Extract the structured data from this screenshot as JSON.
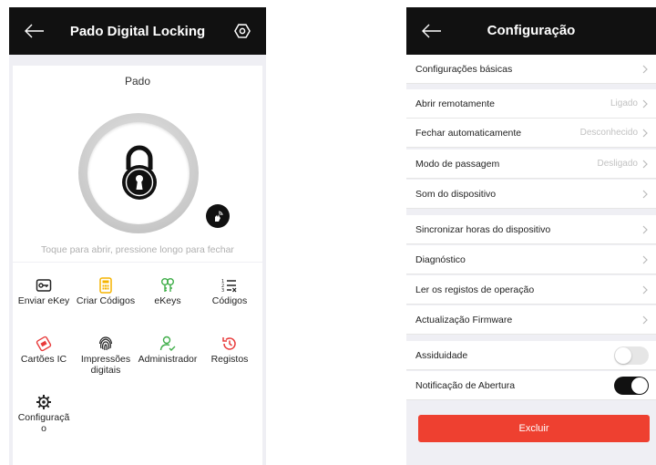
{
  "left": {
    "header": {
      "title": "Pado Digital Locking"
    },
    "lock": {
      "name": "Pado",
      "hint": "Toque para abrir, pressione longo para fechar"
    },
    "grid": [
      {
        "label": "Enviar eKey",
        "icon": "send-ekey-icon"
      },
      {
        "label": "Criar Códigos",
        "icon": "create-codes-icon"
      },
      {
        "label": "eKeys",
        "icon": "ekeys-icon"
      },
      {
        "label": "Códigos",
        "icon": "codes-icon"
      },
      {
        "label": "Cartões IC",
        "icon": "ic-cards-icon"
      },
      {
        "label": "Impressões digitais",
        "icon": "fingerprint-icon"
      },
      {
        "label": "Administrador",
        "icon": "administrator-icon"
      },
      {
        "label": "Registos",
        "icon": "records-icon"
      },
      {
        "label": "Configuração",
        "icon": "settings-icon"
      }
    ],
    "colors": {
      "header": "#111111",
      "codes": "#f5b400",
      "ekeys": "#3fae49",
      "cards": "#e83a3a",
      "admin": "#3fae49",
      "records": "#e83a3a"
    }
  },
  "right": {
    "header": {
      "title": "Configuração"
    },
    "rows": [
      {
        "label": "Configurações básicas",
        "value": ""
      },
      {
        "label": "Abrir remotamente",
        "value": "Ligado"
      },
      {
        "label": "Fechar automaticamente",
        "value": "Desconhecido"
      },
      {
        "label": "Modo de passagem",
        "value": "Desligado"
      },
      {
        "label": "Som do dispositivo",
        "value": ""
      },
      {
        "label": "Sincronizar horas do dispositivo",
        "value": ""
      },
      {
        "label": "Diagnóstico",
        "value": ""
      },
      {
        "label": "Ler os registos de operação",
        "value": ""
      },
      {
        "label": "Actualização Firmware",
        "value": ""
      }
    ],
    "toggles": [
      {
        "label": "Assiduidade",
        "on": false
      },
      {
        "label": "Notificação de Abertura",
        "on": true
      }
    ],
    "delete_label": "Excluir",
    "colors": {
      "delete": "#ee4030"
    }
  }
}
